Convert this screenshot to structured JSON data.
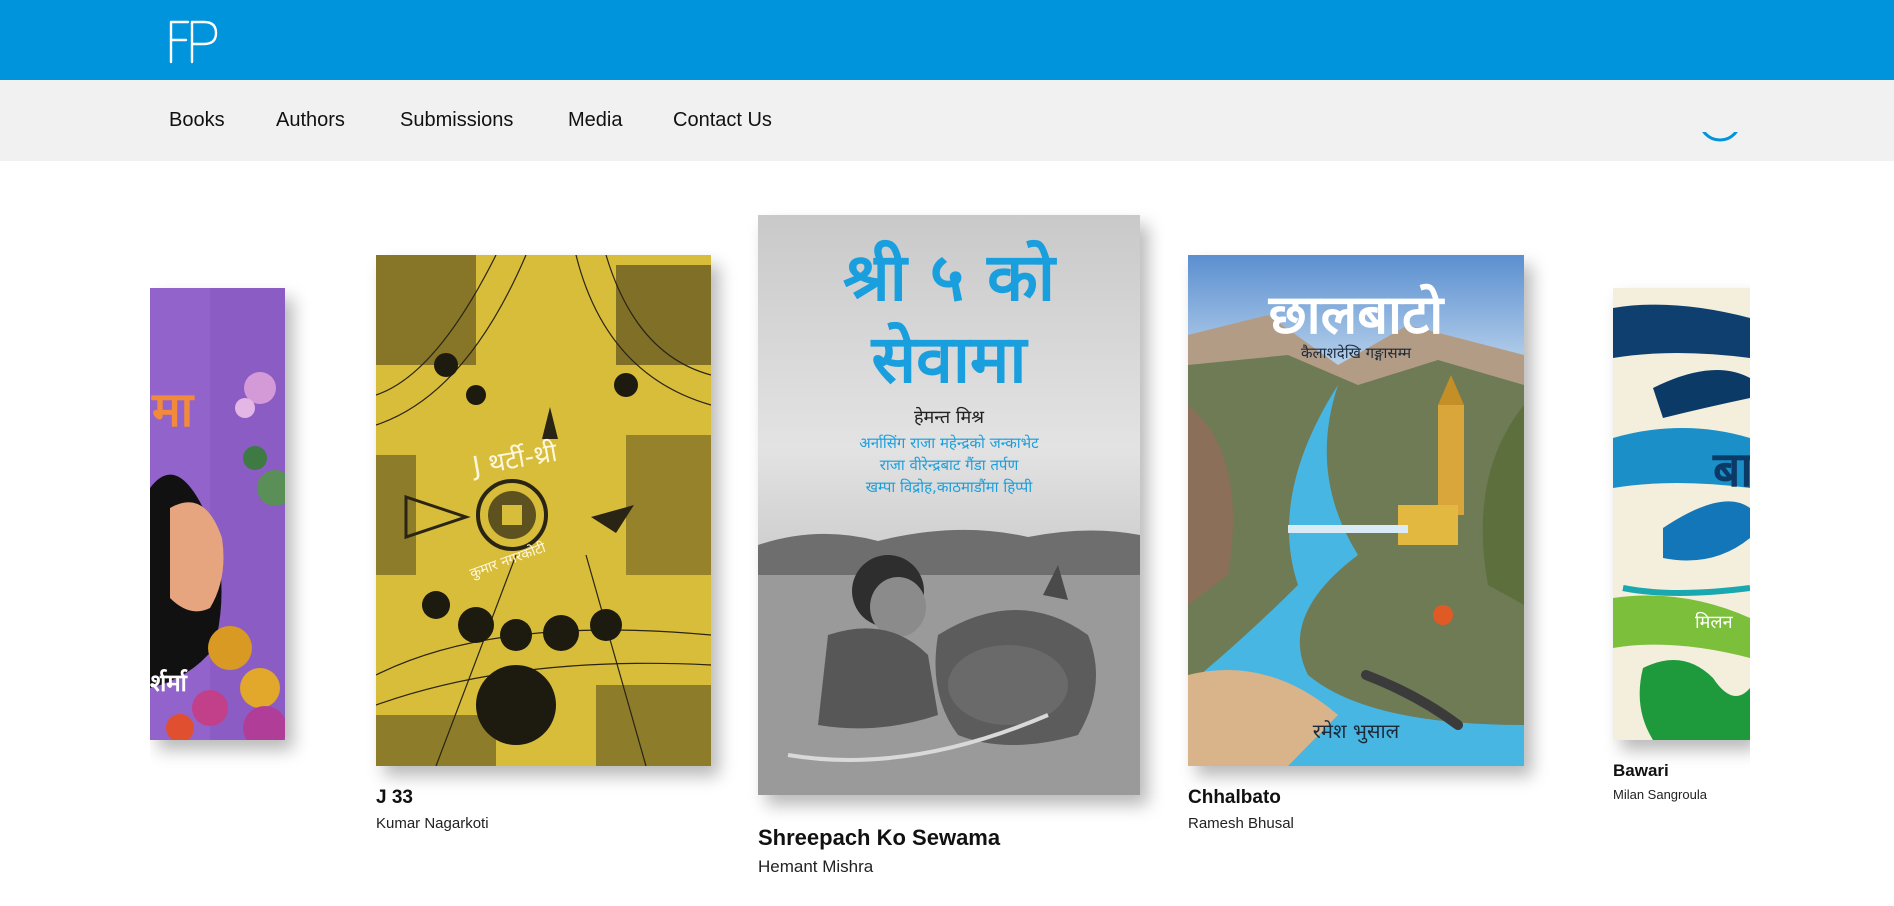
{
  "header": {
    "logo_text": "FP",
    "brand_color": "#0094dc"
  },
  "nav": {
    "items": [
      {
        "label": "Books"
      },
      {
        "label": "Authors"
      },
      {
        "label": "Submissions"
      },
      {
        "label": "Media"
      },
      {
        "label": "Contact Us"
      }
    ]
  },
  "books": [
    {
      "title": "",
      "author": "",
      "cover_text": [
        "मा",
        "र्शर्मा"
      ],
      "cover_color": "#8a5cc4"
    },
    {
      "title": "J 33",
      "author": "Kumar Nagarkoti",
      "cover_text": [
        "J थर्टी-थ्री",
        "कुमार नगरकोटी"
      ],
      "cover_color": "#d8bd3a"
    },
    {
      "title": "Shreepach Ko Sewama",
      "author": "Hemant Mishra",
      "cover_text": [
        "श्री ५ को",
        "सेवामा",
        "हेमन्त मिश्र",
        "अर्नासिंग राजा महेन्द्रको जन्काभेट",
        "राजा वीरेन्द्रबाट गैंडा तर्पण",
        "खम्पा विद्रोह,काठमाडौंमा हिप्पी"
      ],
      "cover_color": "#d9d9d9",
      "accent_color": "#1a9fde"
    },
    {
      "title": "Chhalbato",
      "author": "Ramesh Bhusal",
      "cover_text": [
        "छालबाटो",
        "कैलाशदेखि गङ्गासम्म",
        "रमेश भुसाल"
      ],
      "cover_color": "#5fb9e0"
    },
    {
      "title": "Bawari",
      "author": "Milan Sangroula",
      "cover_text": [
        "बा",
        "मिलन"
      ],
      "cover_color": "#f4eedc"
    }
  ]
}
